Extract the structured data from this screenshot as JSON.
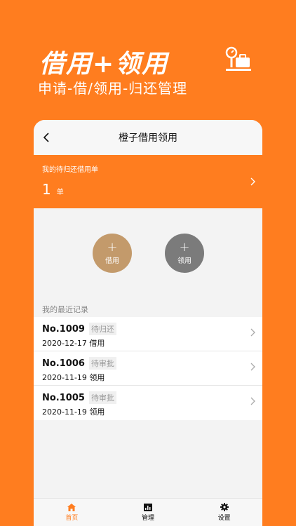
{
  "promo": {
    "title": "借用+领用",
    "subtitle": "申请-借/领用-归还管理",
    "icon": "luggage-scale-icon"
  },
  "nav": {
    "title": "橙子借用领用",
    "back_icon": "chevron-left-icon"
  },
  "pending": {
    "label": "我的待归还借用单",
    "count": "1",
    "unit": "单"
  },
  "actions": {
    "borrow_label": "借用",
    "receive_label": "领用"
  },
  "recent": {
    "heading": "我的最近记录",
    "records": [
      {
        "no": "No.1009",
        "status": "待归还",
        "date_type": "2020-12-17 借用"
      },
      {
        "no": "No.1006",
        "status": "待审批",
        "date_type": "2020-11-19 领用"
      },
      {
        "no": "No.1005",
        "status": "待审批",
        "date_type": "2020-11-19 领用"
      }
    ]
  },
  "tabs": [
    {
      "label": "首页",
      "icon": "home-icon",
      "active": true
    },
    {
      "label": "管理",
      "icon": "chart-icon",
      "active": false
    },
    {
      "label": "设置",
      "icon": "gear-icon",
      "active": false
    }
  ],
  "colors": {
    "brand": "#ff7d1f",
    "borrow": "#c39a6b",
    "receive": "#7b7b7b"
  }
}
